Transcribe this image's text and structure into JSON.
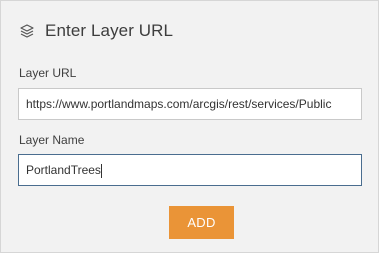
{
  "header": {
    "title": "Enter Layer URL",
    "icon": "layers-icon"
  },
  "layer_url": {
    "label": "Layer URL",
    "value": "https://www.portlandmaps.com/arcgis/rest/services/Public"
  },
  "layer_name": {
    "label": "Layer Name",
    "value": "PortlandTrees"
  },
  "add_button": {
    "label": "ADD",
    "color": "#ea9437"
  }
}
